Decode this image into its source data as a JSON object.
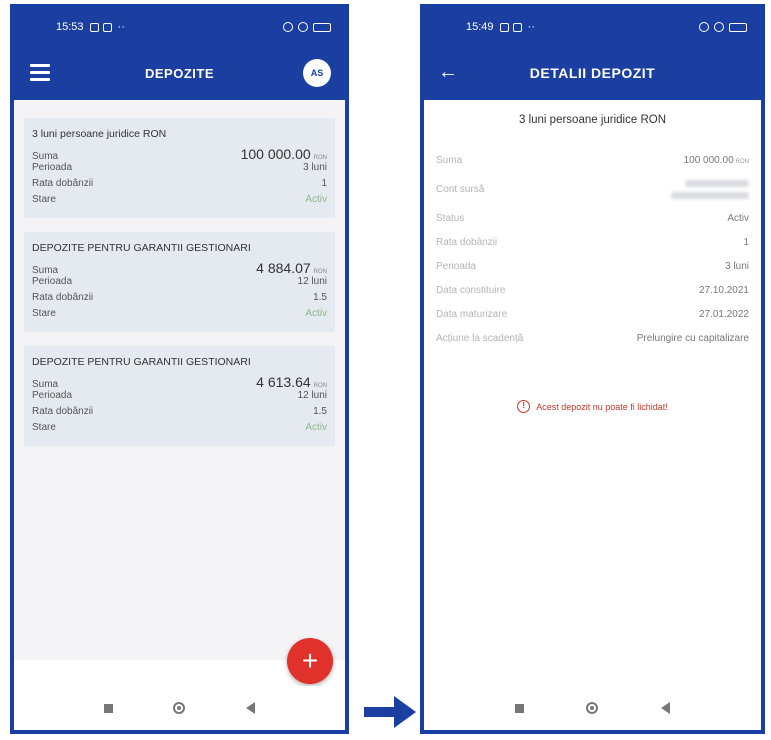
{
  "left": {
    "status_time": "15:53",
    "title": "DEPOZITE",
    "avatar": "AS",
    "cards": [
      {
        "title": "3 luni persoane juridice RON",
        "suma_label": "Suma",
        "suma": "100 000.00",
        "currency": "RON",
        "perioada_label": "Perioada",
        "perioada": "3 luni",
        "rata_label": "Rata dobânzii",
        "rata": "1",
        "stare_label": "Stare",
        "stare": "Activ"
      },
      {
        "title": "DEPOZITE PENTRU GARANTII GESTIONARI",
        "suma_label": "Suma",
        "suma": "4 884.07",
        "currency": "RON",
        "perioada_label": "Perioada",
        "perioada": "12 luni",
        "rata_label": "Rata dobânzii",
        "rata": "1.5",
        "stare_label": "Stare",
        "stare": "Activ"
      },
      {
        "title": "DEPOZITE PENTRU GARANTII GESTIONARI",
        "suma_label": "Suma",
        "suma": "4 613.64",
        "currency": "RON",
        "perioada_label": "Perioada",
        "perioada": "12 luni",
        "rata_label": "Rata dobânzii",
        "rata": "1.5",
        "stare_label": "Stare",
        "stare": "Activ"
      }
    ],
    "fab_label": "+"
  },
  "right": {
    "status_time": "15:49",
    "title": "DETALII DEPOZIT",
    "deposit_title": "3 luni persoane juridice RON",
    "rows": [
      {
        "label": "Suma",
        "value": "100 000.00",
        "currency": "RON"
      },
      {
        "label": "Cont sursă",
        "value": ""
      },
      {
        "label": "Status",
        "value": "Activ"
      },
      {
        "label": "Rata dobânzii",
        "value": "1"
      },
      {
        "label": "Perioada",
        "value": "3 luni"
      },
      {
        "label": "Data constituire",
        "value": "27.10.2021"
      },
      {
        "label": "Data maturizare",
        "value": "27.01.2022"
      },
      {
        "label": "Acțiune la scadență",
        "value": "Prelungire cu capitalizare"
      }
    ],
    "warning": "Acest depozit nu poate fi lichidat!"
  },
  "colors": {
    "brand_blue": "#1a3fa0",
    "fab_red": "#e0312a",
    "card_bg": "#e5e9f0",
    "status_green": "#8fb88f",
    "warning_red": "#c0392b"
  },
  "icons": [
    "menu-icon",
    "avatar",
    "add-icon",
    "back-arrow-icon",
    "warning-icon",
    "nav-recents-icon",
    "nav-home-icon",
    "nav-back-icon",
    "transition-arrow-icon"
  ]
}
